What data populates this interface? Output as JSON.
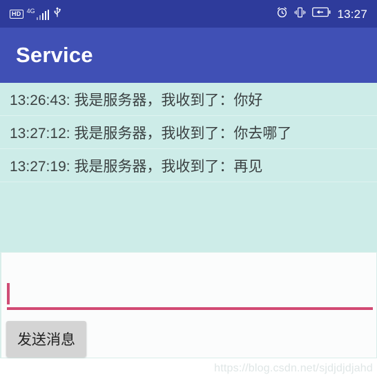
{
  "status_bar": {
    "hd_label": "HD",
    "network_label": "4G",
    "signal_icon": "signal-bars-icon",
    "usb_icon": "usb-icon",
    "alarm_icon": "alarm-clock-icon",
    "vibrate_icon": "vibrate-icon",
    "battery_icon": "battery-charging-icon",
    "clock": "13:27",
    "background_color": "#2e3b9b"
  },
  "app_bar": {
    "title": "Service",
    "background_color": "#4050b5",
    "text_color": "#ffffff"
  },
  "message_list": {
    "background_color": "#cdece8",
    "text_color": "#3b4142",
    "items": [
      {
        "text": "13:26:43: 我是服务器，我收到了：你好"
      },
      {
        "text": "13:27:12: 我是服务器，我收到了：你去哪了"
      },
      {
        "text": "13:27:19: 我是服务器，我收到了：再见"
      }
    ]
  },
  "input_panel": {
    "message_input": {
      "value": "",
      "placeholder": "",
      "underline_color": "#d24a73",
      "caret_color": "#cf4d76"
    },
    "send_button": {
      "label": "发送消息",
      "background_color": "#d4d4d4"
    }
  },
  "watermark": {
    "text": "https://blog.csdn.net/sjdjdjdjahd",
    "color": "#dfe6e6"
  }
}
